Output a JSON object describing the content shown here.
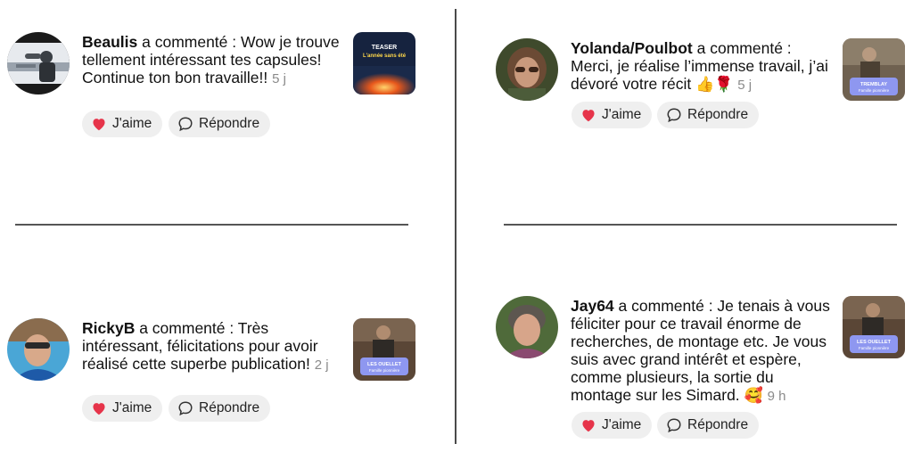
{
  "actions": {
    "like_label": "J'aime",
    "reply_label": "Répondre"
  },
  "comments": [
    {
      "user": "Beaulis",
      "verb": " a commenté : ",
      "text": "Wow je trouve tellement intéressant tes capsules! Continue ton bon travaille!! ",
      "time": "5 j",
      "thumb_lines": [
        "TEASER",
        "L'année sans été"
      ]
    },
    {
      "user": "Yolanda/Poulbot",
      "verb": " a commenté : ",
      "text": "Merci, je réalise l’immense travail, j’ai dévoré votre récit ",
      "emoji": "👍🌹",
      "time": "5 j",
      "thumb_lines": [
        "TREMBLAY",
        "Famille pionnière"
      ]
    },
    {
      "user": "RickyB",
      "verb": " a commenté : ",
      "text": "Très intéressant, félicitations pour avoir réalisé cette superbe publication! ",
      "time": "2 j",
      "thumb_lines": [
        "LES OUELLET",
        "Famille pionnière"
      ]
    },
    {
      "user": "Jay64",
      "verb": " a commenté : ",
      "text": "Je tenais à vous féliciter pour ce travail énorme de recherches, de montage etc. Je vous suis avec grand intérêt et espère, comme plusieurs, la sortie du montage sur les Simard. ",
      "emoji": "🥰",
      "time": "9 h",
      "thumb_lines": [
        "LES OUELLET",
        "Famille pionnière"
      ]
    }
  ]
}
